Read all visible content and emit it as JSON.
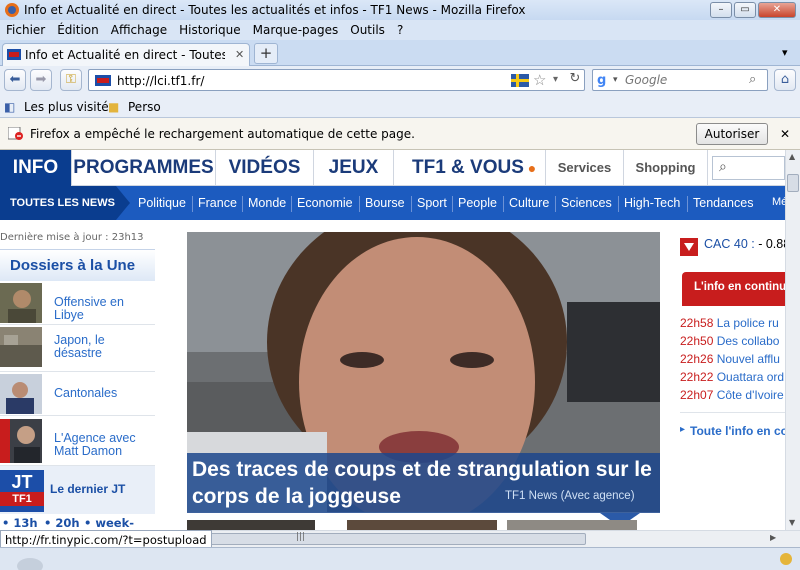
{
  "window": {
    "title": "Info et Actualité en direct - Toutes les actualités et infos - TF1 News - Mozilla Firefox"
  },
  "menu": [
    "Fichier",
    "Édition",
    "Affichage",
    "Historique",
    "Marque-pages",
    "Outils",
    "?"
  ],
  "tab": {
    "label": "Info et Actualité en direct - Toutes les ac..."
  },
  "address": {
    "url": "http://lci.tf1.fr/"
  },
  "search": {
    "placeholder": "Google"
  },
  "bookmarks": [
    "Les plus visités",
    "Perso"
  ],
  "notification": {
    "message": "Firefox a empêché le rechargement automatique de cette page.",
    "button": "Autoriser"
  },
  "site": {
    "topnav": [
      "INFO",
      "PROGRAMMES",
      "VIDÉOS",
      "JEUX",
      "TF1 & VOUS",
      "Services",
      "Shopping"
    ],
    "subnav_title": "TOUTES LES NEWS",
    "subnav": [
      "Politique",
      "France",
      "Monde",
      "Economie",
      "Bourse",
      "Sport",
      "People",
      "Culture",
      "Sciences",
      "High-Tech",
      "Tendances",
      "Mé"
    ],
    "last_update": "Dernière mise à jour : 23h13",
    "dossiers_title": "Dossiers à la Une",
    "dossiers": [
      "Offensive en Libye",
      "Japon, le désastre",
      "Cantonales",
      "L'Agence avec Matt Damon"
    ],
    "jt": {
      "logo": "JT",
      "logo_sub": "TF1",
      "label": "Le dernier JT",
      "times": [
        "• 13h",
        "• 20h",
        "• week-end"
      ]
    },
    "headline": {
      "text": "Des traces de coups et de strangulation sur le corps de la joggeuse",
      "source": "TF1 News (Avec agence)"
    },
    "cac": {
      "label": "CAC 40 :",
      "value": "- 0.88"
    },
    "live_title": "L'info en continu",
    "news": [
      {
        "time": "22h58",
        "text": "La police ru"
      },
      {
        "time": "22h50",
        "text": "Des collabo"
      },
      {
        "time": "22h26",
        "text": "Nouvel afflu"
      },
      {
        "time": "22h22",
        "text": "Ouattara ord"
      },
      {
        "time": "22h07",
        "text": "Côte d'Ivoire"
      }
    ],
    "all_info": "Toute l'info en co"
  },
  "status": {
    "url": "http://fr.tinypic.com/?t=postupload"
  },
  "colors": {
    "brand_blue": "#0a3d8f",
    "nav_blue": "#1c5bbf",
    "live_red": "#c81d1d",
    "link_blue": "#2a6cc9"
  }
}
